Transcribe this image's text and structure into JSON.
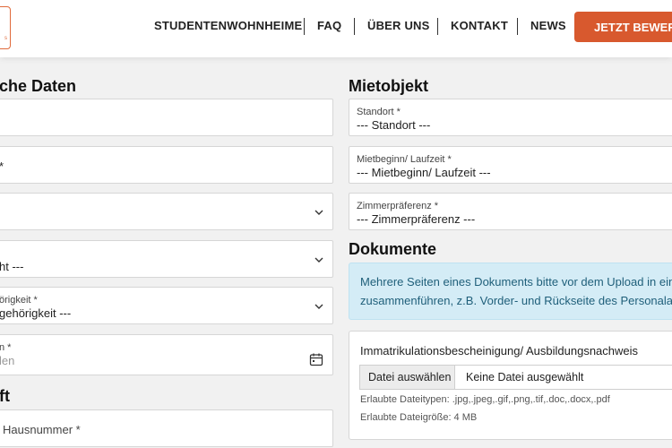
{
  "header": {
    "nav": [
      "STUDENTENWOHNHEIME",
      "FAQ",
      "ÜBER UNS",
      "KONTAKT",
      "NEWS"
    ],
    "cta_label": "JETZT BEWERBEN",
    "brand_color": "#d8592e"
  },
  "left": {
    "heading": "che Daten",
    "fields": [
      {
        "value": ""
      },
      {
        "value": "*"
      },
      {
        "value": ""
      },
      {
        "label": "",
        "value": "ht ---"
      },
      {
        "label": "örigkeit *",
        "value": "gehörigkeit ---"
      },
      {
        "label": "n *",
        "placeholder": "len"
      }
    ],
    "heading2": "ft",
    "street_placeholder": "Hausnummer *"
  },
  "right": {
    "heading": "Mietobjekt",
    "fields": [
      {
        "label": "Standort *",
        "value": "--- Standort ---"
      },
      {
        "label": "Mietbeginn/ Laufzeit *",
        "value": "--- Mietbeginn/ Laufzeit ---"
      },
      {
        "label": "Zimmerpräferenz *",
        "value": "--- Zimmerpräferenz ---"
      }
    ],
    "docs_heading": "Dokumente",
    "info_line1": "Mehrere Seiten eines Dokuments bitte vor dem Upload in eine",
    "info_line2": "zusammenführen, z.B. Vorder- und Rückseite des Personalausw",
    "upload": {
      "title": "Immatrikulationsbescheinigung/ Ausbildungsnachweis",
      "button": "Datei auswählen",
      "filename": "Keine Datei ausgewählt",
      "types": "Erlaubte Dateitypen: .jpg,.jpeg,.gif,.png,.tif,.doc,.docx,.pdf",
      "size": "Erlaubte Dateigröße: 4 MB"
    }
  }
}
